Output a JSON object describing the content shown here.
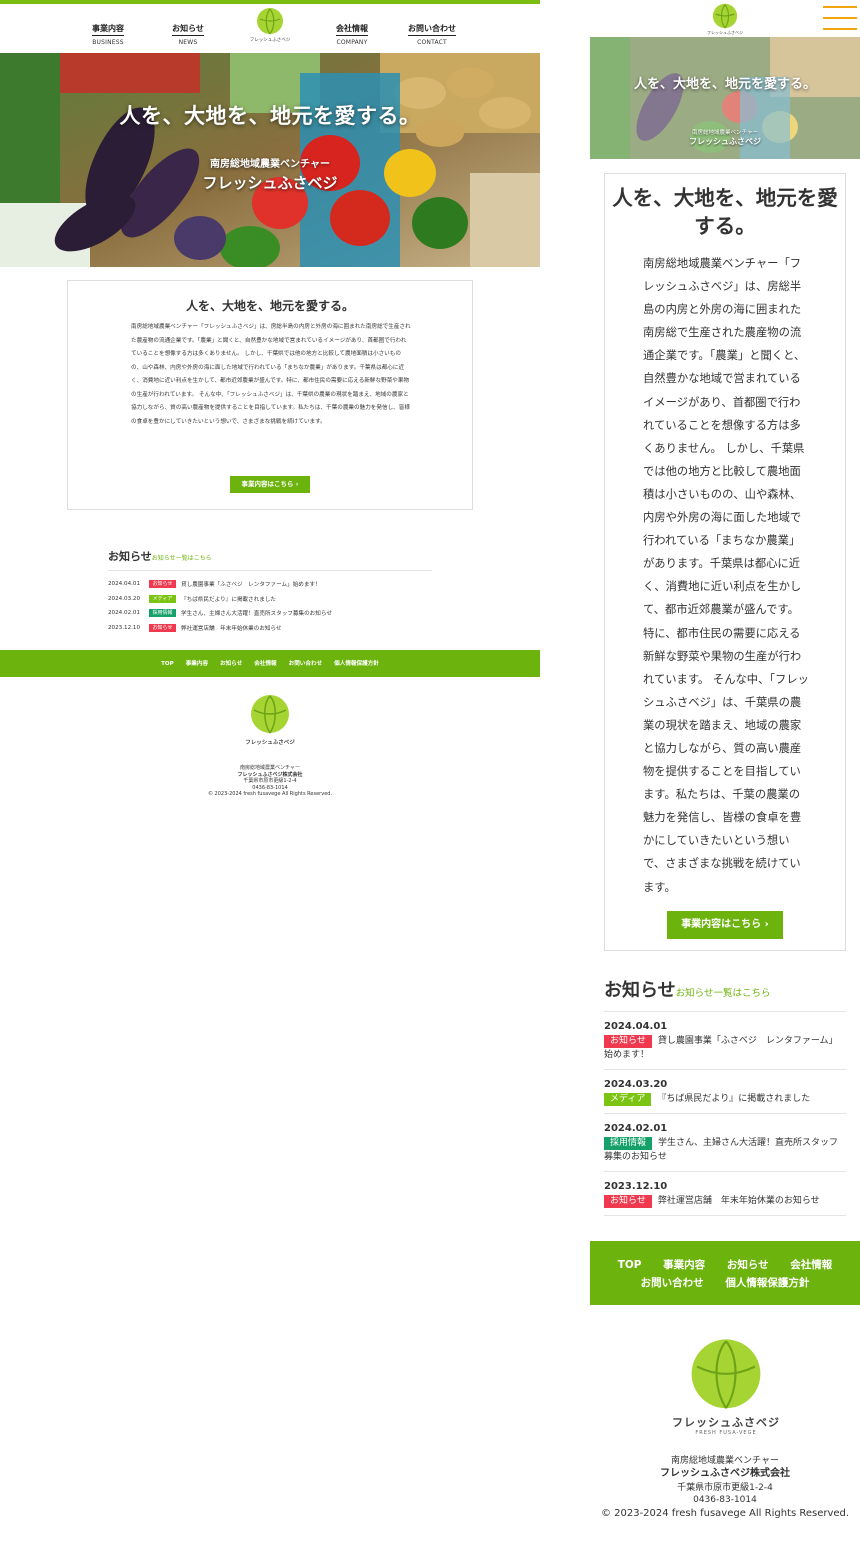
{
  "nav": {
    "items": [
      {
        "jp": "事業内容",
        "en": "BUSINESS"
      },
      {
        "jp": "お知らせ",
        "en": "NEWS"
      },
      {
        "jp": "会社情報",
        "en": "COMPANY"
      },
      {
        "jp": "お問い合わせ",
        "en": "CONTACT"
      }
    ]
  },
  "brand": {
    "logo_text": "フレッシュふさベジ",
    "logo_sub": "FRESH FUSA-VEGE"
  },
  "hero": {
    "headline": "人を、大地を、地元を愛する。",
    "subtitle": "南房総地域農業ベンチャー",
    "name": "フレッシュふさベジ"
  },
  "intro": {
    "title": "人を、大地を、地元を愛する。",
    "body": "南房総地域農業ベンチャー「フレッシュふさベジ」は、房総半島の内房と外房の海に囲まれた南房総で生産された農産物の流通企業です。「農業」と聞くと、自然豊かな地域で営まれているイメージがあり、首都圏で行われていることを想像する方は多くありません。 しかし、千葉県では他の地方と比較して農地面積は小さいものの、山や森林、内房や外房の海に面した地域で行われている「まちなか農業」があります。千葉県は都心に近く、消費地に近い利点を生かして、都市近郊農業が盛んです。特に、都市住民の需要に応える新鮮な野菜や果物の生産が行われています。 そんな中、「フレッシュふさベジ」は、千葉県の農業の現状を踏まえ、地域の農家と協力しながら、質の高い農産物を提供することを目指しています。私たちは、千葉の農業の魅力を発信し、皆様の食卓を豊かにしていきたいという想いで、さまざまな挑戦を続けています。",
    "button": "事業内容はこちら"
  },
  "news": {
    "title": "お知らせ",
    "link": "お知らせ一覧はこちら",
    "items": [
      {
        "date": "2024.04.01",
        "tag": "お知らせ",
        "color": "#f0394f",
        "text": "貸し農園事業「ふさベジ　レンタファーム」始めます！"
      },
      {
        "date": "2024.03.20",
        "tag": "メディア",
        "color": "#7cc414",
        "text": "『ちば県民だより』に掲載されました"
      },
      {
        "date": "2024.02.01",
        "tag": "採用情報",
        "color": "#16a06a",
        "text": "学生さん、主婦さん大活躍！直売所スタッフ募集のお知らせ"
      },
      {
        "date": "2023.12.10",
        "tag": "お知らせ",
        "color": "#f0394f",
        "text": "弊社運営店舗　年末年始休業のお知らせ"
      }
    ]
  },
  "footer": {
    "links": [
      "TOP",
      "事業内容",
      "お知らせ",
      "会社情報",
      "お問い合わせ",
      "個人情報保護方針"
    ],
    "tagline": "南房総地域農業ベンチャー",
    "company": "フレッシュふさベジ株式会社",
    "address": "千葉県市原市更級1-2-4",
    "tel": "0436-83-1014",
    "copyright": "© 2023-2024 fresh fusavege All Rights Reserved."
  },
  "colors": {
    "accent": "#6cb30d",
    "hamburger": "#f2a50c"
  }
}
